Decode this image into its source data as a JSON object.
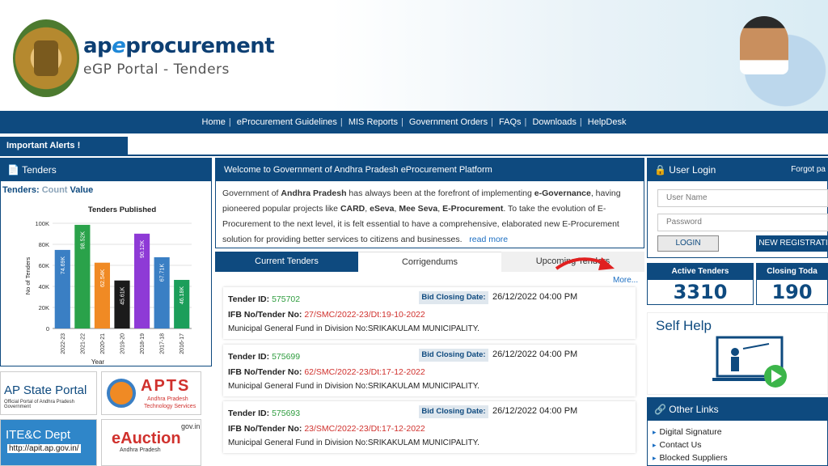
{
  "header": {
    "brand_pre": "ap",
    "brand_e": "e",
    "brand_post": "procurement",
    "subtitle": "eGP Portal - Tenders"
  },
  "nav": {
    "items": [
      "Home",
      "eProcurement Guidelines",
      "MIS Reports",
      "Government Orders",
      "FAQs",
      "Downloads",
      "HelpDesk"
    ]
  },
  "alerts": {
    "label": "Important Alerts !"
  },
  "tenders_panel": {
    "title": "Tenders",
    "count_label": "Tenders:",
    "count_word": "Count",
    "value_word": "Value",
    "icon": "document-icon"
  },
  "chart_data": {
    "type": "bar",
    "title": "Tenders Published",
    "xlabel": "Year",
    "ylabel": "No of Tenders",
    "ylim": [
      0,
      100000
    ],
    "yticks": [
      "0",
      "20K",
      "40K",
      "60K",
      "80K",
      "100K"
    ],
    "categories": [
      "2022-23",
      "2021-22",
      "2020-21",
      "2019-20",
      "2018-19",
      "2017-18",
      "2016-17"
    ],
    "values": [
      74690,
      98520,
      62540,
      45610,
      90120,
      67710,
      46180
    ],
    "data_labels": [
      "74.69K",
      "98.52K",
      "62.54K",
      "45.61K",
      "90.12K",
      "67.71K",
      "46.18K"
    ],
    "colors": [
      "#3a7fc4",
      "#2aa24a",
      "#f08a24",
      "#1b1b1b",
      "#8e3ad6",
      "#3a7fc4",
      "#1c9e5a"
    ],
    "grid": true
  },
  "welcome": {
    "title": "Welcome to Government of Andhra Pradesh eProcurement Platform",
    "p1": "Government of ",
    "b1": "Andhra Pradesh",
    "p2": " has always been at the forefront of implementing ",
    "b2": "e-Governance",
    "p3": ", having pioneered popular projects like ",
    "b3": "CARD",
    "p4": ", ",
    "b4": "eSeva",
    "p5": ", ",
    "b5": "Mee Seva",
    "p6": ", ",
    "b6": "E-Procurement",
    "p7": ". To take the evolution of E-Procurement to the next level, it is felt essential to have a comprehensive, elaborated new E-Procurement solution for providing better services to citizens and businesses.",
    "read_more": "read more"
  },
  "tabs": [
    "Current Tenders",
    "Corrigendums",
    "Upcoming Tenders"
  ],
  "more": "More...",
  "tenders": [
    {
      "id_label": "Tender ID:",
      "id": "575702",
      "bid_label": "Bid Closing Date:",
      "bid_date": "26/12/2022 04:00 PM",
      "ifb_label": "IFB No/Tender No:",
      "ifb": "27/SMC/2022-23/Dt:19-10-2022",
      "desc": "Municipal General Fund in Division No:SRIKAKULAM MUNICIPALITY."
    },
    {
      "id_label": "Tender ID:",
      "id": "575699",
      "bid_label": "Bid Closing Date:",
      "bid_date": "26/12/2022 04:00 PM",
      "ifb_label": "IFB No/Tender No:",
      "ifb": "62/SMC/2022-23/Dt:17-12-2022",
      "desc": "Municipal General Fund in Division No:SRIKAKULAM MUNICIPALITY."
    },
    {
      "id_label": "Tender ID:",
      "id": "575693",
      "bid_label": "Bid Closing Date:",
      "bid_date": "26/12/2022 04:00 PM",
      "ifb_label": "IFB No/Tender No:",
      "ifb": "23/SMC/2022-23/Dt:17-12-2022",
      "desc": "Municipal General Fund in Division No:SRIKAKULAM MUNICIPALITY."
    }
  ],
  "login": {
    "title": "User Login",
    "forgot": "Forgot pa",
    "username_placeholder": "User Name",
    "password_placeholder": "Password",
    "login_btn": "LOGIN",
    "register_btn": "NEW REGISTRATI",
    "icon": "lock-icon"
  },
  "stats": [
    {
      "label": "Active Tenders",
      "value": "3310"
    },
    {
      "label": "Closing Toda",
      "value": "190"
    }
  ],
  "self_help": {
    "title": "Self Help"
  },
  "other_links": {
    "title": "Other Links",
    "icon": "link-icon",
    "items": [
      "Digital Signature",
      "Contact Us",
      "Blocked Suppliers"
    ]
  },
  "portals": {
    "ap_state": "AP State Portal",
    "ap_state_sub": "Official Portal of Andhra Pradesh Government",
    "apts": "APTS",
    "apts_sub1": "Andhra Pradesh",
    "apts_sub2": "Technology Services",
    "itec": "ITE&C Dept",
    "itec_url": "http://apit.ap.gov.in/",
    "eauction": "eAuction",
    "eauction_gov": "gov.in",
    "eauction_sub": "Andhra Pradesh"
  }
}
